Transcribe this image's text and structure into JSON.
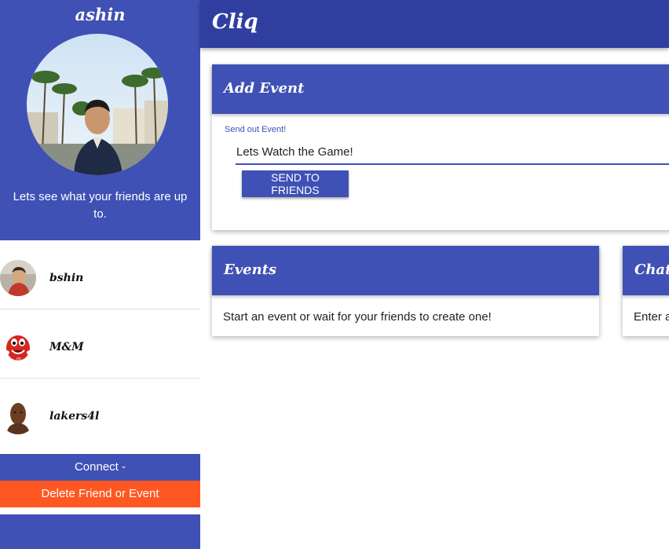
{
  "sidebar": {
    "username": "ashin",
    "tagline": "Lets see what your friends are up to.",
    "friends": [
      {
        "name": "bshin"
      },
      {
        "name": "M&M"
      },
      {
        "name": "lakers4l"
      }
    ],
    "connect_label": "Connect -",
    "delete_label": "Delete Friend or Event"
  },
  "header": {
    "title": "Cliq"
  },
  "add_event": {
    "title": "Add Event",
    "field_label": "Send out Event!",
    "input_value": "Lets Watch the Game!",
    "send_label": "SEND TO FRIENDS"
  },
  "events": {
    "title": "Events",
    "empty_text": "Start an event or wait for your friends to create one!"
  },
  "chat": {
    "title": "Chat",
    "placeholder_text": "Enter a"
  },
  "colors": {
    "primary": "#3f51b5",
    "primary_dark": "#303f9f",
    "accent": "#ff5722"
  }
}
